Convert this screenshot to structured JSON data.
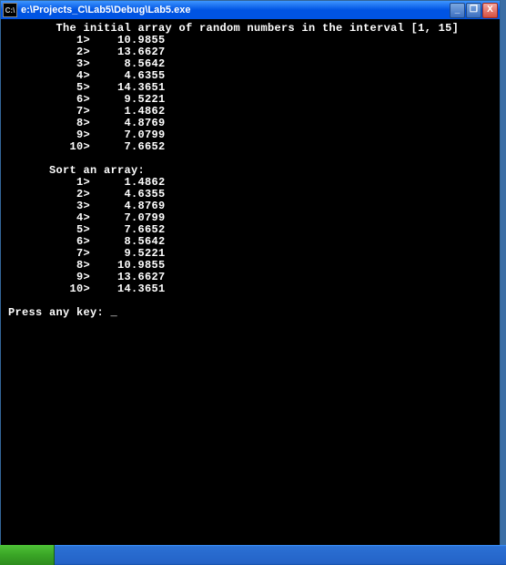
{
  "title_prefix": "C:\\",
  "title_path": "e:\\Projects_C\\Lab5\\Debug\\Lab5.exe",
  "buttons": {
    "minimize": "_",
    "maximize": "❐",
    "close": "X"
  },
  "line_header": "       The initial array of random numbers in the interval [1, 15]",
  "initial": [
    {
      "i": " 1>",
      "v": "10.9855"
    },
    {
      "i": " 2>",
      "v": "13.6627"
    },
    {
      "i": " 3>",
      "v": " 8.5642"
    },
    {
      "i": " 4>",
      "v": " 4.6355"
    },
    {
      "i": " 5>",
      "v": "14.3651"
    },
    {
      "i": " 6>",
      "v": " 9.5221"
    },
    {
      "i": " 7>",
      "v": " 1.4862"
    },
    {
      "i": " 8>",
      "v": " 4.8769"
    },
    {
      "i": " 9>",
      "v": " 7.0799"
    },
    {
      "i": "10>",
      "v": " 7.6652"
    }
  ],
  "sort_header": "      Sort an array:",
  "sorted": [
    {
      "i": " 1>",
      "v": " 1.4862"
    },
    {
      "i": " 2>",
      "v": " 4.6355"
    },
    {
      "i": " 3>",
      "v": " 4.8769"
    },
    {
      "i": " 4>",
      "v": " 7.0799"
    },
    {
      "i": " 5>",
      "v": " 7.6652"
    },
    {
      "i": " 6>",
      "v": " 8.5642"
    },
    {
      "i": " 7>",
      "v": " 9.5221"
    },
    {
      "i": " 8>",
      "v": "10.9855"
    },
    {
      "i": " 9>",
      "v": "13.6627"
    },
    {
      "i": "10>",
      "v": "14.3651"
    }
  ],
  "prompt": "Press any key: ",
  "cursor": "_"
}
